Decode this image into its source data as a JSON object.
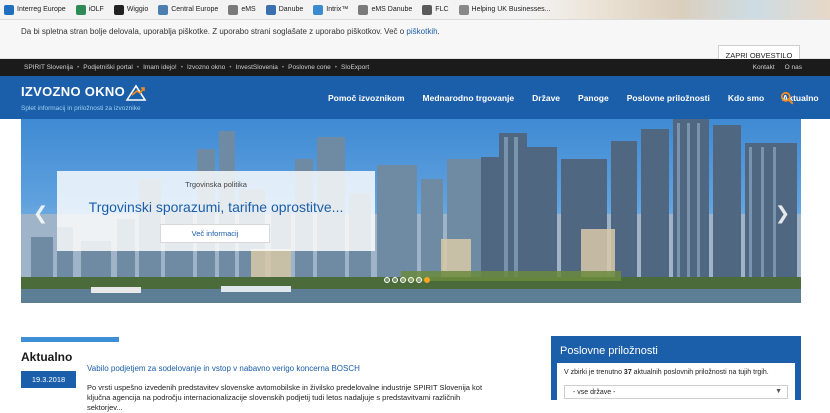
{
  "bookmarks": [
    {
      "label": "Interreg Europe",
      "color": "#1f6fc0"
    },
    {
      "label": "iOLF",
      "color": "#2e8b57"
    },
    {
      "label": "Wiggio",
      "color": "#222222"
    },
    {
      "label": "Central Europe",
      "color": "#4a7fb0"
    },
    {
      "label": "eMS",
      "color": "#7a7a7a"
    },
    {
      "label": "Danube",
      "color": "#3a6fb0"
    },
    {
      "label": "Intrix™",
      "color": "#3b8bd0"
    },
    {
      "label": "eMS Danube",
      "color": "#7a7a7a"
    },
    {
      "label": "FLC",
      "color": "#5a5a5a"
    },
    {
      "label": "Helping UK Businesses...",
      "color": "#888888"
    }
  ],
  "cookie": {
    "text": "Da bi spletna stran bolje delovala, uporablja piškotke. Z uporabo strani soglašate z uporabo piškotkov. Več o ",
    "link": "piškotkih",
    "button": "ZAPRI OBVESTILO"
  },
  "topbar": {
    "nav": [
      "SPIRIT Slovenija",
      "Podjetniški portal",
      "Imam idejo!",
      "Izvozno okno",
      "InvestSlovenia",
      "Poslovne cone",
      "SloExport"
    ],
    "right": [
      "Kontakt",
      "O nas"
    ]
  },
  "header": {
    "logo": "IZVOZNO OKNO",
    "tagline": "Splet informacij in priložnosti za izvoznike",
    "nav": [
      "Pomoč izvoznikom",
      "Mednarodno trgovanje",
      "Države",
      "Panoge",
      "Poslovne priložnosti",
      "Kdo smo",
      "Aktualno"
    ],
    "accent": "#f28c1e",
    "brand": "#1b5ea9"
  },
  "hero": {
    "kicker": "Trgovinska politika",
    "title": "Trgovinski sporazumi, tarifne oprostitve...",
    "button": "Več informacij",
    "slides": 6,
    "active_slide": 5
  },
  "news": {
    "heading": "Aktualno",
    "date": "19.3.2018",
    "title": "Vabilo podjetjem za sodelovanje in vstop v nabavno verigo koncerna BOSCH",
    "body": "Po vrsti uspešno izvedenih predstavitev slovenske avtomobilske in živilsko predelovalne industrije SPIRIT Slovenija kot ključna agencija na področju internacionalizacije slovenskih podjetij tudi letos nadaljuje s predstavitvami različnih sektorjev..."
  },
  "opportunities": {
    "title": "Poslovne priložnosti",
    "text_before": "V zbirki je trenutno ",
    "count": "37",
    "text_after": " aktualnih poslovnih priložnosti na tujih trgih.",
    "select_value": "- vse države -"
  }
}
